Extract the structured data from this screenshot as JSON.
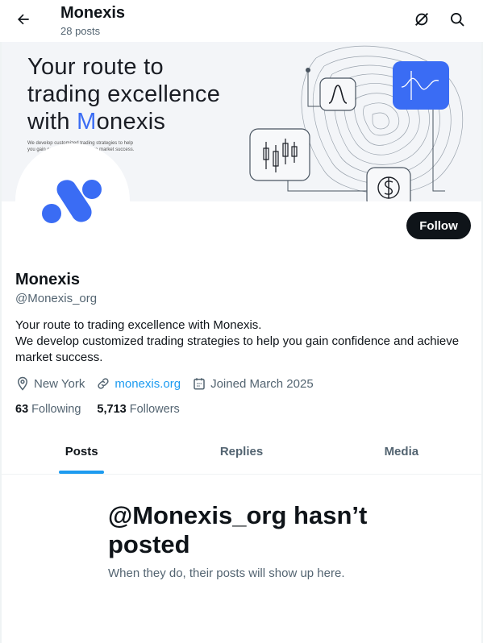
{
  "header": {
    "title": "Monexis",
    "post_count": "28 posts",
    "back_icon": "arrow-left-icon",
    "grok_icon": "slashed-circle-icon",
    "search_icon": "search-icon"
  },
  "banner": {
    "headline_line1": "Your route to",
    "headline_line2": "trading excellence",
    "headline_line3_pre": "with ",
    "headline_line3_m": "M",
    "headline_line3_rest": "onexis",
    "small_text_line1": "We develop customized trading strategies to help",
    "small_text_line2": "you gain confidence and achieve market success."
  },
  "profile": {
    "follow_label": "Follow",
    "name": "Monexis",
    "handle": "@Monexis_org",
    "bio_line1": "Your route to trading excellence with Monexis.",
    "bio_line2": "We develop customized trading strategies to help you gain confidence and achieve",
    "bio_line3": "market success.",
    "location": "New York",
    "website": "monexis.org",
    "joined": "Joined March 2025",
    "following_count": "63",
    "following_label": "Following",
    "followers_count": "5,713",
    "followers_label": "Followers"
  },
  "tabs": [
    {
      "label": "Posts",
      "active": true
    },
    {
      "label": "Replies",
      "active": false
    },
    {
      "label": "Media",
      "active": false
    }
  ],
  "empty_state": {
    "title_line1": "@Monexis_org hasn’t",
    "title_line2": "posted",
    "subtitle": "When they do, their posts will show up here."
  },
  "colors": {
    "accent": "#1d9bf0",
    "brand_blue": "#3a6cf4",
    "text_primary": "#0f1419",
    "text_secondary": "#536471"
  }
}
